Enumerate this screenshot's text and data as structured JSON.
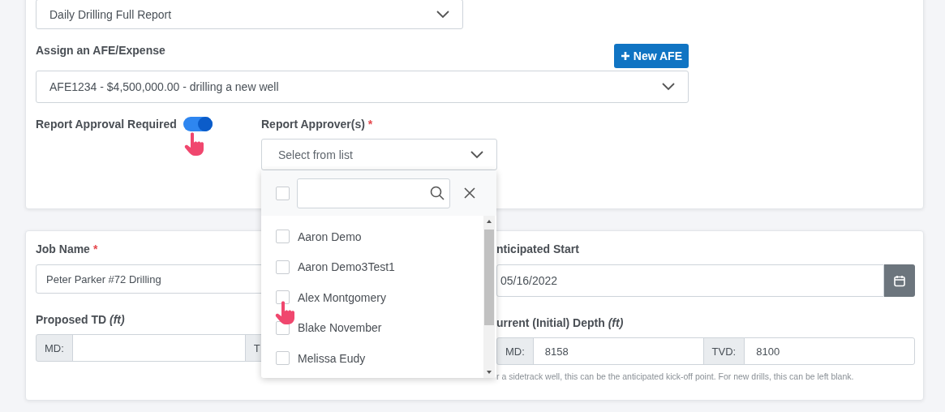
{
  "report_type": {
    "value": "Daily Drilling Full Report"
  },
  "afe": {
    "label": "Assign an AFE/Expense",
    "button": "New AFE",
    "value": "AFE1234 - $4,500,000.00 - drilling a new well"
  },
  "approval": {
    "label": "Report Approval Required",
    "on": true
  },
  "approvers": {
    "label": "Report Approver(s)",
    "required_mark": "*",
    "placeholder": "Select from list",
    "dropdown": {
      "select_all_checked": false,
      "options": [
        {
          "name": "Aaron Demo",
          "checked": false
        },
        {
          "name": "Aaron Demo3Test1",
          "checked": false
        },
        {
          "name": "Alex Montgomery",
          "checked": false
        },
        {
          "name": "Blake November",
          "checked": false
        },
        {
          "name": "Melissa Eudy",
          "checked": false
        }
      ]
    }
  },
  "job": {
    "label": "Job Name",
    "required_mark": "*",
    "value": "Peter Parker #72 Drilling"
  },
  "proposed_td": {
    "label": "Proposed TD",
    "unit": "(ft)",
    "md_label": "MD:",
    "tvd_label": "T"
  },
  "anticipated_start": {
    "label": "nticipated Start",
    "value": "05/16/2022"
  },
  "current_depth": {
    "label": "urrent (Initial) Depth",
    "unit": "(ft)",
    "md_label": "MD:",
    "md_value": "8158",
    "tvd_label": "TVD:",
    "tvd_value": "8100",
    "hint": "r a sidetrack well, this can be the anticipated kick-off point. For new drills, this can be left blank."
  }
}
